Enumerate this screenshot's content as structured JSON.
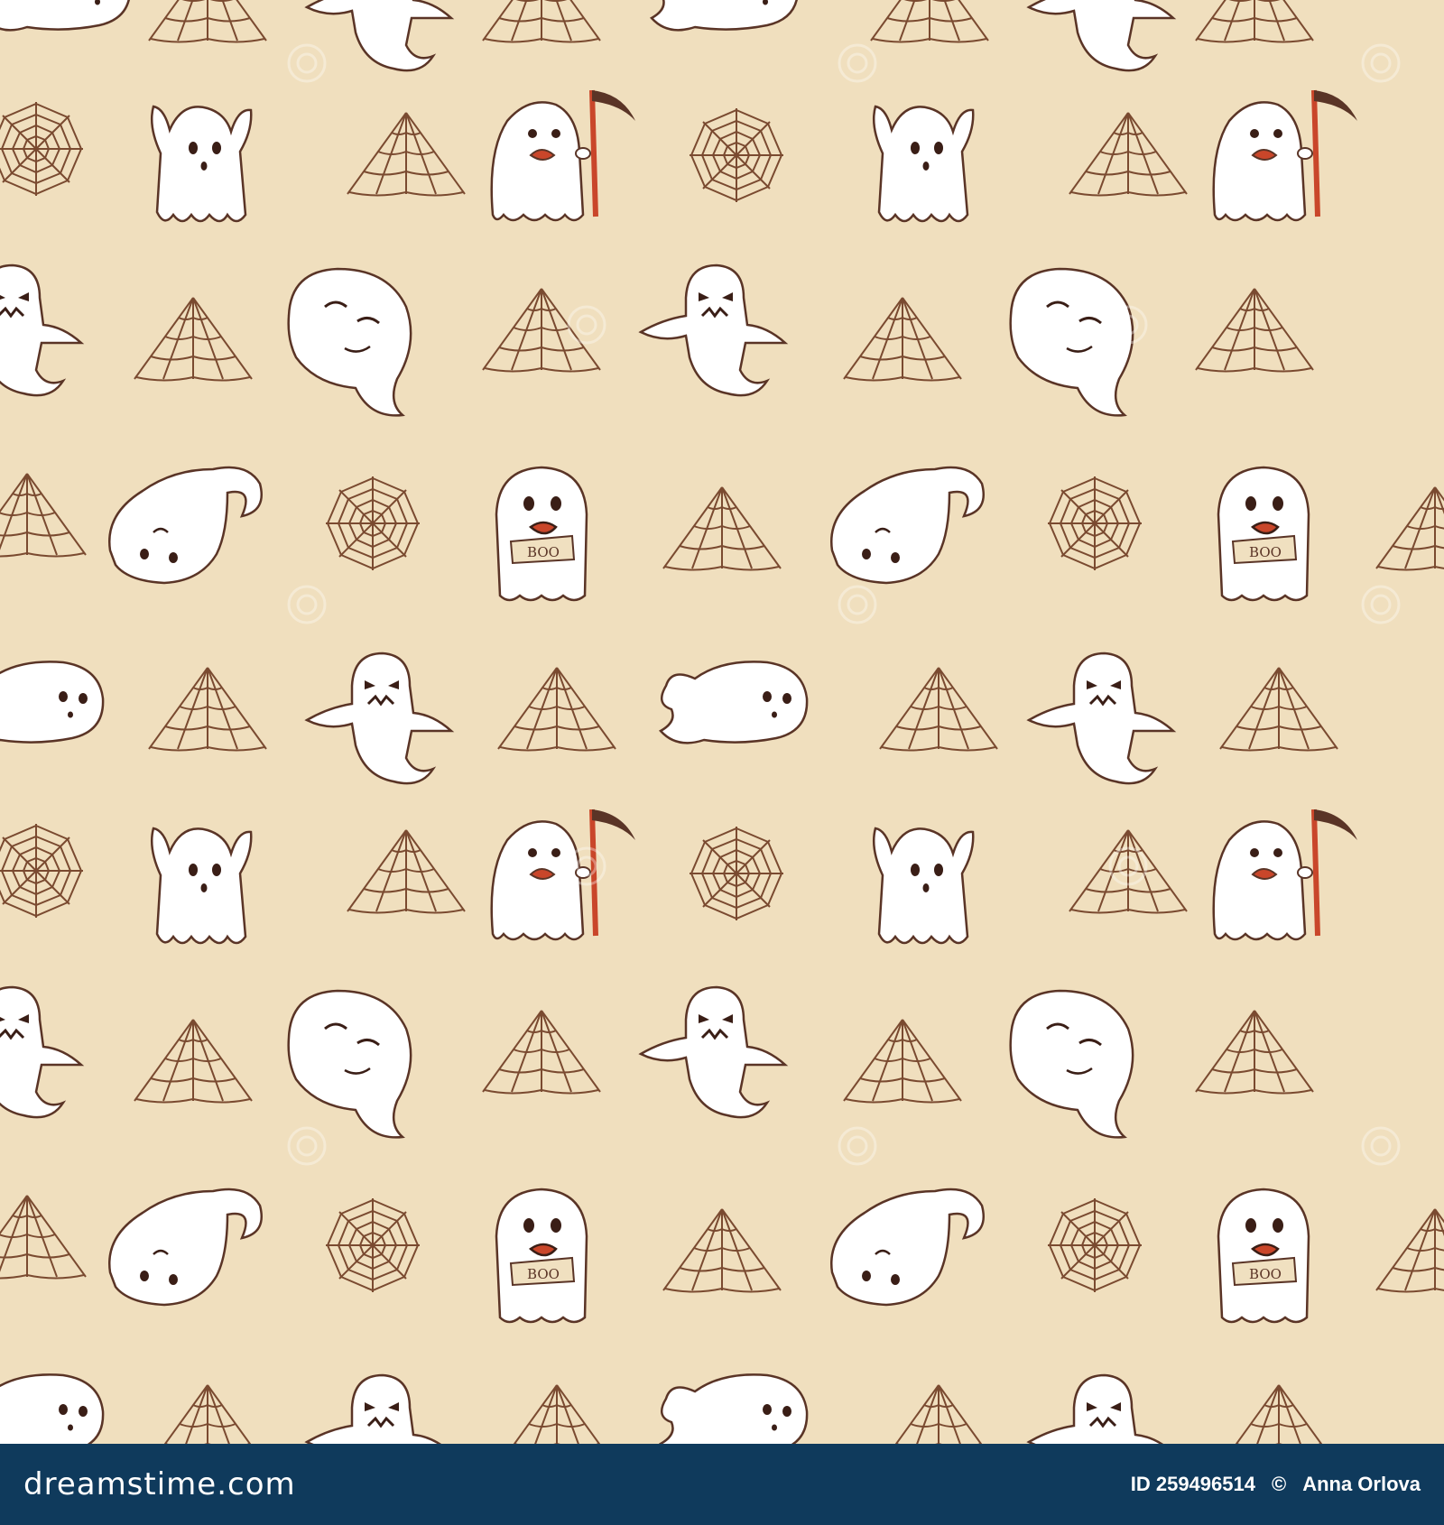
{
  "pattern": {
    "background_color": "#f0dfbe",
    "ink_color": "#5a3426",
    "web_color": "#7a4a30",
    "ghost_fill": "#ffffff",
    "scythe_color": "#c9462a",
    "sign_text": "BOO",
    "watermark_text": "dreamstime",
    "motifs": [
      "ghost-raised-arms",
      "ghost-scythe",
      "ghost-smirk",
      "ghost-angry",
      "ghost-boo-sign",
      "ghost-upside-down",
      "ghost-flying",
      "spider-web-round",
      "spider-web-corner"
    ]
  },
  "footer": {
    "background_color": "#0f3a5c",
    "brand": "dreamstime.com",
    "image_id": "ID 259496514",
    "separator": "©",
    "author": "Anna Orlova"
  }
}
